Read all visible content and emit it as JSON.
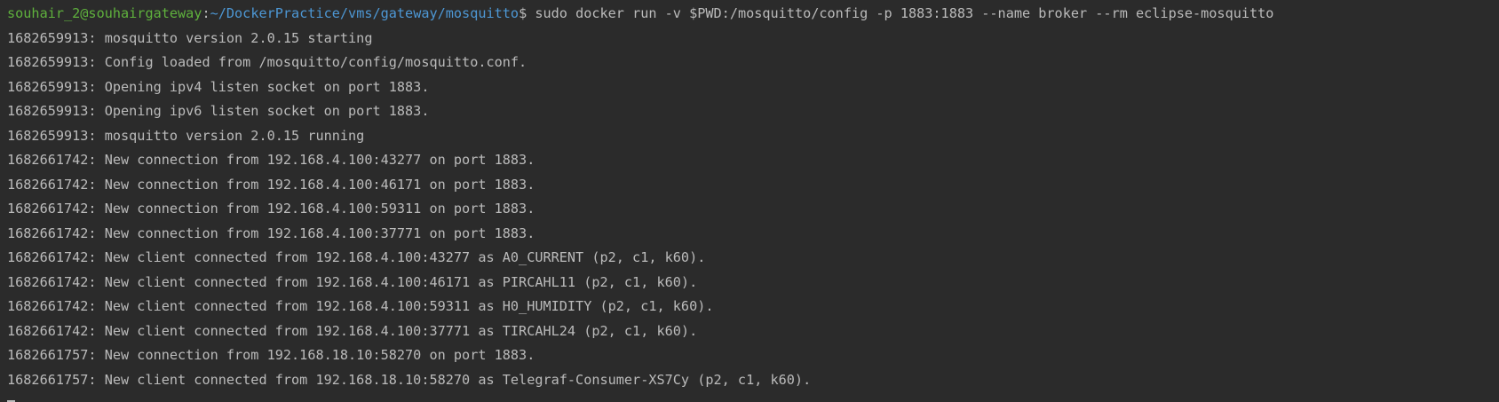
{
  "prompt": {
    "user_host": "souhair_2@souhairgateway",
    "separator": ":",
    "path": "~/DockerPractice/vms/gateway/mosquitto",
    "command": "$ sudo docker run -v $PWD:/mosquitto/config -p 1883:1883 --name broker --rm eclipse-mosquitto"
  },
  "output_lines": [
    "1682659913: mosquitto version 2.0.15 starting",
    "1682659913: Config loaded from /mosquitto/config/mosquitto.conf.",
    "1682659913: Opening ipv4 listen socket on port 1883.",
    "1682659913: Opening ipv6 listen socket on port 1883.",
    "1682659913: mosquitto version 2.0.15 running",
    "1682661742: New connection from 192.168.4.100:43277 on port 1883.",
    "1682661742: New connection from 192.168.4.100:46171 on port 1883.",
    "1682661742: New connection from 192.168.4.100:59311 on port 1883.",
    "1682661742: New connection from 192.168.4.100:37771 on port 1883.",
    "1682661742: New client connected from 192.168.4.100:43277 as A0_CURRENT (p2, c1, k60).",
    "1682661742: New client connected from 192.168.4.100:46171 as PIRCAHL11 (p2, c1, k60).",
    "1682661742: New client connected from 192.168.4.100:59311 as H0_HUMIDITY (p2, c1, k60).",
    "1682661742: New client connected from 192.168.4.100:37771 as TIRCAHL24 (p2, c1, k60).",
    "1682661757: New connection from 192.168.18.10:58270 on port 1883.",
    "1682661757: New client connected from 192.168.18.10:58270 as Telegraf-Consumer-XS7Cy (p2, c1, k60)."
  ],
  "colors": {
    "background": "#2b2b2b",
    "text": "#bbbbbb",
    "user_host": "#5fb13d",
    "path": "#4d97d4"
  }
}
